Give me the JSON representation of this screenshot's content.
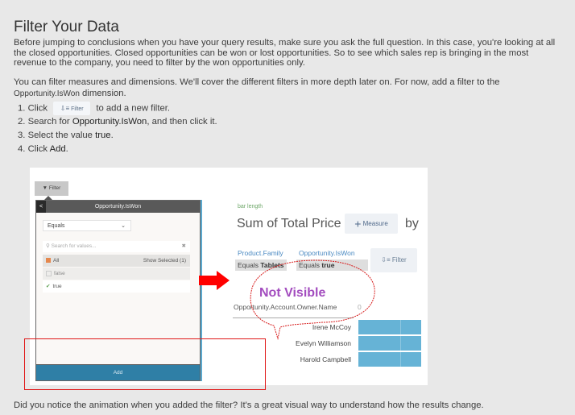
{
  "heading": "Filter Your Data",
  "paragraph1": "Before jumping to conclusions when you have your query results, make sure you ask the full question. In this case, you're looking at all the closed opportunities. Closed opportunities can be won or lost opportunities. So to see which sales rep is bringing in the most revenue to the company, you need to filter by the won opportunities only.",
  "paragraph2": {
    "text_before": "You can filter measures and dimensions. We'll cover the different filters in more depth later on. For now, add a filter to the ",
    "dimension": "Opportunity.IsWon",
    "text_after": " dimension."
  },
  "steps": [
    {
      "num": "1.",
      "before": "Click",
      "inline_button": "Filter",
      "after": "to add a new filter."
    },
    {
      "num": "2.",
      "before": "Search for ",
      "bold": "Opportunity.IsWon",
      "after": ", and then click it."
    },
    {
      "num": "3.",
      "before": "Select the value ",
      "bold": "true",
      "after": "."
    },
    {
      "num": "4.",
      "before": "Click ",
      "bold": "Add",
      "after": "."
    }
  ],
  "screenshot": {
    "filter_button": "Filter",
    "panel": {
      "title": "Opportunity.IsWon",
      "back": "<",
      "operator": "Equals",
      "search_placeholder": "Search for values...",
      "all_label": "All",
      "show_selected": "Show Selected (1)",
      "values": [
        "false",
        "true"
      ],
      "selected": "true",
      "add_button": "Add"
    },
    "bar_length_label": "bar length",
    "measure_title": "Sum of Total Price",
    "measure_button": "Measure",
    "by_label": "by",
    "filters": [
      {
        "field": "Product.Family",
        "op": "Equals",
        "value": "Tablets"
      },
      {
        "field": "Opportunity.IsWon",
        "op": "Equals",
        "value": "true"
      }
    ],
    "filter_button2": "Filter",
    "group_header": "Opportunity.Account.Owner.Name",
    "axis_zero": "0",
    "rows": [
      "Irene McCoy",
      "Evelyn Williamson",
      "Harold Campbell"
    ],
    "annotation": "Not Visible"
  },
  "paragraph_last": "Did you notice the animation when you added the filter? It's a great visual way to understand how the results change.",
  "colors": {
    "accent_blue": "#2f7fa6",
    "bar_blue": "#66b3d6",
    "annotation_red": "#e01818",
    "annotation_purple": "#a34dbf"
  }
}
